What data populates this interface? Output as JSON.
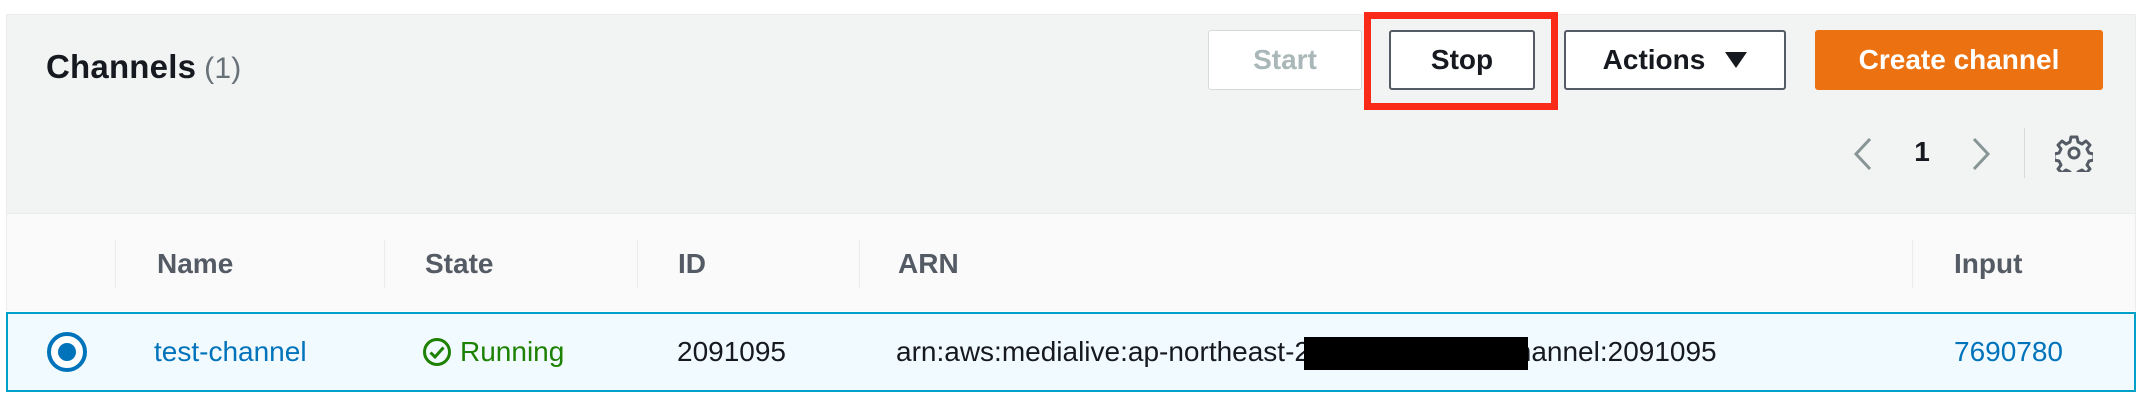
{
  "panel": {
    "title": "Channels",
    "count": "(1)"
  },
  "toolbar": {
    "start_label": "Start",
    "stop_label": "Stop",
    "actions_label": "Actions",
    "create_label": "Create channel"
  },
  "pagination": {
    "current_page": "1"
  },
  "table": {
    "columns": [
      "Name",
      "State",
      "ID",
      "ARN",
      "Input"
    ],
    "rows": [
      {
        "selected": true,
        "name": "test-channel",
        "state": "Running",
        "id": "2091095",
        "arn_prefix": "arn:aws:medialive:ap-northeast-2",
        "arn_suffix": ":channel:2091095",
        "input": "7690780"
      }
    ]
  },
  "colors": {
    "primary_button": "#ec7211",
    "highlight": "#fa2a19",
    "link": "#0073bb",
    "running": "#1d8102",
    "selected_row_border": "#00a1c9",
    "selected_row_bg": "#f1faff"
  },
  "icons": {
    "prev": "chevron-left-icon",
    "next": "chevron-right-icon",
    "settings": "gear-icon",
    "state": "check-circle-icon",
    "actions_caret": "caret-down-icon",
    "row_select": "radio-selected-icon"
  }
}
